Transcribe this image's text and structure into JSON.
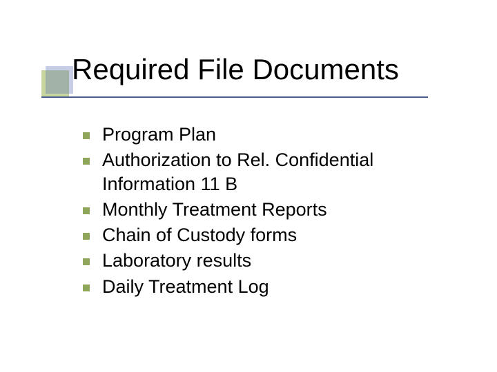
{
  "slide": {
    "title": "Required File Documents",
    "bullets": [
      "Program Plan",
      "Authorization to Rel. Confidential Information 11 B",
      "Monthly Treatment Reports",
      "Chain of Custody forms",
      "Laboratory results",
      "Daily Treatment Log"
    ]
  }
}
